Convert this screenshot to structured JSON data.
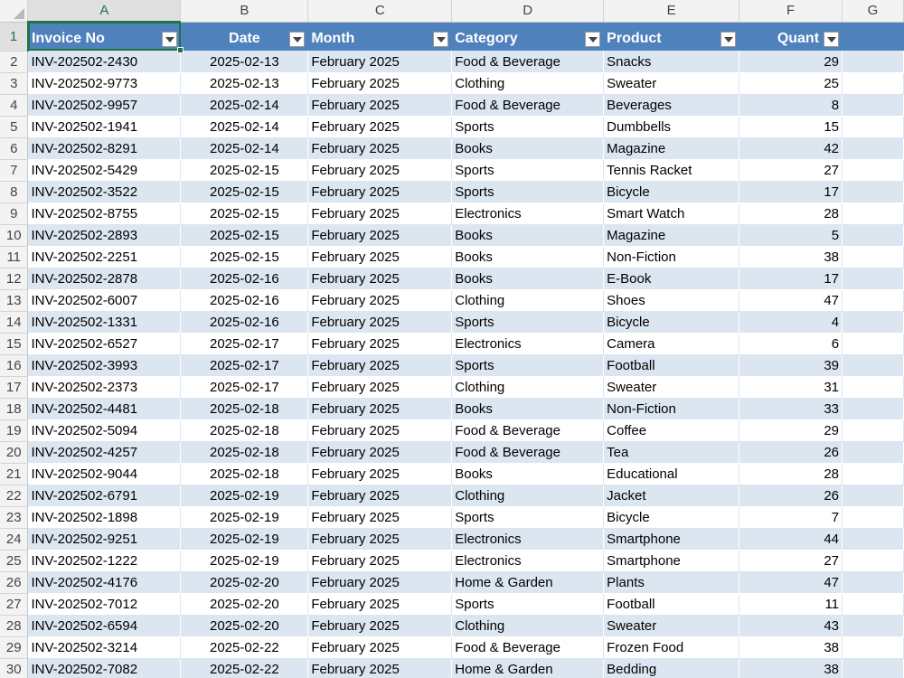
{
  "columns": [
    "A",
    "B",
    "C",
    "D",
    "E",
    "F",
    "G"
  ],
  "headers": [
    "Invoice No",
    "Date",
    "Month",
    "Category",
    "Product",
    "Quant",
    ""
  ],
  "rows": [
    [
      "INV-202502-2430",
      "2025-02-13",
      "February 2025",
      "Food & Beverage",
      "Snacks",
      "29"
    ],
    [
      "INV-202502-9773",
      "2025-02-13",
      "February 2025",
      "Clothing",
      "Sweater",
      "25"
    ],
    [
      "INV-202502-9957",
      "2025-02-14",
      "February 2025",
      "Food & Beverage",
      "Beverages",
      "8"
    ],
    [
      "INV-202502-1941",
      "2025-02-14",
      "February 2025",
      "Sports",
      "Dumbbells",
      "15"
    ],
    [
      "INV-202502-8291",
      "2025-02-14",
      "February 2025",
      "Books",
      "Magazine",
      "42"
    ],
    [
      "INV-202502-5429",
      "2025-02-15",
      "February 2025",
      "Sports",
      "Tennis Racket",
      "27"
    ],
    [
      "INV-202502-3522",
      "2025-02-15",
      "February 2025",
      "Sports",
      "Bicycle",
      "17"
    ],
    [
      "INV-202502-8755",
      "2025-02-15",
      "February 2025",
      "Electronics",
      "Smart Watch",
      "28"
    ],
    [
      "INV-202502-2893",
      "2025-02-15",
      "February 2025",
      "Books",
      "Magazine",
      "5"
    ],
    [
      "INV-202502-2251",
      "2025-02-15",
      "February 2025",
      "Books",
      "Non-Fiction",
      "38"
    ],
    [
      "INV-202502-2878",
      "2025-02-16",
      "February 2025",
      "Books",
      "E-Book",
      "17"
    ],
    [
      "INV-202502-6007",
      "2025-02-16",
      "February 2025",
      "Clothing",
      "Shoes",
      "47"
    ],
    [
      "INV-202502-1331",
      "2025-02-16",
      "February 2025",
      "Sports",
      "Bicycle",
      "4"
    ],
    [
      "INV-202502-6527",
      "2025-02-17",
      "February 2025",
      "Electronics",
      "Camera",
      "6"
    ],
    [
      "INV-202502-3993",
      "2025-02-17",
      "February 2025",
      "Sports",
      "Football",
      "39"
    ],
    [
      "INV-202502-2373",
      "2025-02-17",
      "February 2025",
      "Clothing",
      "Sweater",
      "31"
    ],
    [
      "INV-202502-4481",
      "2025-02-18",
      "February 2025",
      "Books",
      "Non-Fiction",
      "33"
    ],
    [
      "INV-202502-5094",
      "2025-02-18",
      "February 2025",
      "Food & Beverage",
      "Coffee",
      "29"
    ],
    [
      "INV-202502-4257",
      "2025-02-18",
      "February 2025",
      "Food & Beverage",
      "Tea",
      "26"
    ],
    [
      "INV-202502-9044",
      "2025-02-18",
      "February 2025",
      "Books",
      "Educational",
      "28"
    ],
    [
      "INV-202502-6791",
      "2025-02-19",
      "February 2025",
      "Clothing",
      "Jacket",
      "26"
    ],
    [
      "INV-202502-1898",
      "2025-02-19",
      "February 2025",
      "Sports",
      "Bicycle",
      "7"
    ],
    [
      "INV-202502-9251",
      "2025-02-19",
      "February 2025",
      "Electronics",
      "Smartphone",
      "44"
    ],
    [
      "INV-202502-1222",
      "2025-02-19",
      "February 2025",
      "Electronics",
      "Smartphone",
      "27"
    ],
    [
      "INV-202502-4176",
      "2025-02-20",
      "February 2025",
      "Home & Garden",
      "Plants",
      "47"
    ],
    [
      "INV-202502-7012",
      "2025-02-20",
      "February 2025",
      "Sports",
      "Football",
      "11"
    ],
    [
      "INV-202502-6594",
      "2025-02-20",
      "February 2025",
      "Clothing",
      "Sweater",
      "43"
    ],
    [
      "INV-202502-3214",
      "2025-02-22",
      "February 2025",
      "Food & Beverage",
      "Frozen Food",
      "38"
    ],
    [
      "INV-202502-7082",
      "2025-02-22",
      "February 2025",
      "Home & Garden",
      "Bedding",
      "38"
    ]
  ],
  "colors": {
    "header_fill": "#4f81bd",
    "band_fill": "#dce6f1",
    "selection": "#217346"
  }
}
